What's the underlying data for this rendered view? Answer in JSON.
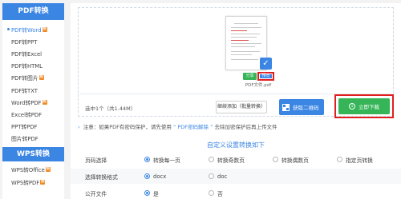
{
  "sidebar": {
    "header": "PDF转换",
    "items": [
      {
        "label": "PDF转Word",
        "hot": true,
        "active": true
      },
      {
        "label": "PDF转PPT",
        "hot": false
      },
      {
        "label": "PDF转Excel",
        "hot": false
      },
      {
        "label": "PDF转HTML",
        "hot": false
      },
      {
        "label": "PDF转图片",
        "hot": true
      },
      {
        "label": "PDF转TXT",
        "hot": false
      },
      {
        "label": "Word转PDF",
        "hot": true
      },
      {
        "label": "Excel转PDF",
        "hot": false
      },
      {
        "label": "PPT转PDF",
        "hot": false
      },
      {
        "label": "图片转PDF",
        "hot": false
      }
    ],
    "header2": "WPS转换",
    "items2": [
      {
        "label": "WPS转Office",
        "hot": true
      },
      {
        "label": "WPS转PDF",
        "hot": true
      }
    ],
    "hot_label": "热"
  },
  "file": {
    "share_label": "分享",
    "preview_label": "预览",
    "name": "PDF文件.pdf",
    "check_icon": "✓"
  },
  "toolbar": {
    "selected_info": "选中1个（共1.44M）",
    "add_label": "继续添加（批量转换）",
    "qr_label": "获取二维码",
    "download_label": "立即下载",
    "download_icon": "↓"
  },
  "notice": {
    "icon": "›",
    "prefix": "注意：如果PDF有密码保护，请先使用",
    "link": "“ PDF密码解除 ”",
    "suffix": "去除加密保护后再上传文件"
  },
  "settings": {
    "title": "自定义设置转换如下",
    "rows": [
      {
        "label": "页码选择",
        "options": [
          "转换每一页",
          "转换奇数页",
          "转换偶数页",
          "指定页转换"
        ],
        "selected": 0
      },
      {
        "label": "选择转换格式",
        "options": [
          "docx",
          "doc"
        ],
        "selected": 0
      },
      {
        "label": "公开文件",
        "options": [
          "是",
          "否"
        ],
        "selected": 0
      }
    ]
  }
}
